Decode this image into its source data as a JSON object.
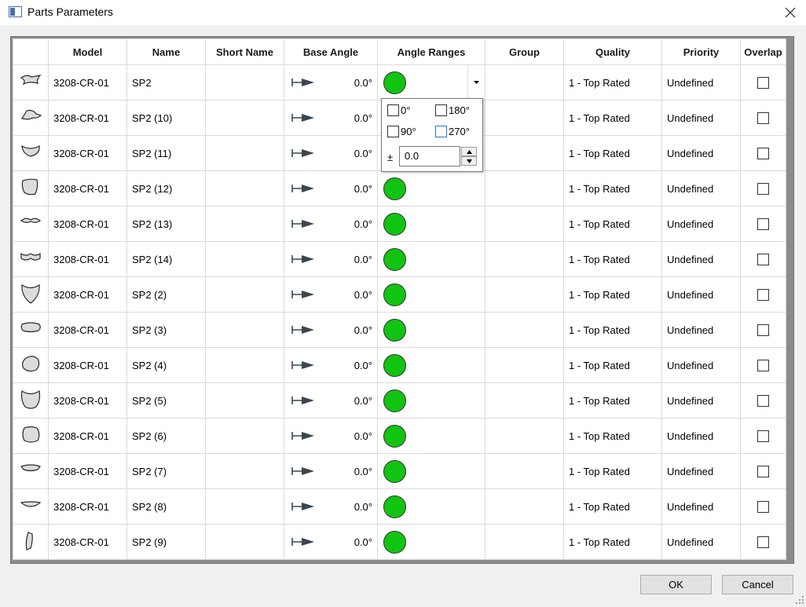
{
  "window": {
    "title": "Parts Parameters"
  },
  "columns": [
    "",
    "Model",
    "Name",
    "Short Name",
    "Base Angle",
    "Angle Ranges",
    "Group",
    "Quality",
    "Priority",
    "Overlap"
  ],
  "colors": {
    "range_dot": "#11c411",
    "focus_border": "#1e7fd6"
  },
  "rows": [
    {
      "icon": "part-shape-icon",
      "model": "3208-CR-01",
      "name": "SP2",
      "short_name": "",
      "base_angle": "0.0°",
      "group": "",
      "quality": "1 - Top Rated",
      "priority": "Undefined"
    },
    {
      "icon": "part-shape-icon",
      "model": "3208-CR-01",
      "name": "SP2 (10)",
      "short_name": "",
      "base_angle": "0.0°",
      "group": "",
      "quality": "1 - Top Rated",
      "priority": "Undefined"
    },
    {
      "icon": "part-shape-icon",
      "model": "3208-CR-01",
      "name": "SP2 (11)",
      "short_name": "",
      "base_angle": "0.0°",
      "group": "",
      "quality": "1 - Top Rated",
      "priority": "Undefined"
    },
    {
      "icon": "part-shape-icon",
      "model": "3208-CR-01",
      "name": "SP2 (12)",
      "short_name": "",
      "base_angle": "0.0°",
      "group": "",
      "quality": "1 - Top Rated",
      "priority": "Undefined"
    },
    {
      "icon": "part-shape-icon",
      "model": "3208-CR-01",
      "name": "SP2 (13)",
      "short_name": "",
      "base_angle": "0.0°",
      "group": "",
      "quality": "1 - Top Rated",
      "priority": "Undefined"
    },
    {
      "icon": "part-shape-icon",
      "model": "3208-CR-01",
      "name": "SP2 (14)",
      "short_name": "",
      "base_angle": "0.0°",
      "group": "",
      "quality": "1 - Top Rated",
      "priority": "Undefined"
    },
    {
      "icon": "part-shape-icon",
      "model": "3208-CR-01",
      "name": "SP2 (2)",
      "short_name": "",
      "base_angle": "0.0°",
      "group": "",
      "quality": "1 - Top Rated",
      "priority": "Undefined"
    },
    {
      "icon": "part-shape-icon",
      "model": "3208-CR-01",
      "name": "SP2 (3)",
      "short_name": "",
      "base_angle": "0.0°",
      "group": "",
      "quality": "1 - Top Rated",
      "priority": "Undefined"
    },
    {
      "icon": "part-shape-icon",
      "model": "3208-CR-01",
      "name": "SP2 (4)",
      "short_name": "",
      "base_angle": "0.0°",
      "group": "",
      "quality": "1 - Top Rated",
      "priority": "Undefined"
    },
    {
      "icon": "part-shape-icon",
      "model": "3208-CR-01",
      "name": "SP2 (5)",
      "short_name": "",
      "base_angle": "0.0°",
      "group": "",
      "quality": "1 - Top Rated",
      "priority": "Undefined"
    },
    {
      "icon": "part-shape-icon",
      "model": "3208-CR-01",
      "name": "SP2 (6)",
      "short_name": "",
      "base_angle": "0.0°",
      "group": "",
      "quality": "1 - Top Rated",
      "priority": "Undefined"
    },
    {
      "icon": "part-shape-icon",
      "model": "3208-CR-01",
      "name": "SP2 (7)",
      "short_name": "",
      "base_angle": "0.0°",
      "group": "",
      "quality": "1 - Top Rated",
      "priority": "Undefined"
    },
    {
      "icon": "part-shape-icon",
      "model": "3208-CR-01",
      "name": "SP2 (8)",
      "short_name": "",
      "base_angle": "0.0°",
      "group": "",
      "quality": "1 - Top Rated",
      "priority": "Undefined"
    },
    {
      "icon": "part-shape-icon",
      "model": "3208-CR-01",
      "name": "SP2 (9)",
      "short_name": "",
      "base_angle": "0.0°",
      "group": "",
      "quality": "1 - Top Rated",
      "priority": "Undefined"
    }
  ],
  "angle_popup": {
    "options": [
      "0°",
      "180°",
      "90°",
      "270°"
    ],
    "plus_minus": "±",
    "tolerance": "0.0"
  },
  "buttons": {
    "ok": "OK",
    "cancel": "Cancel"
  }
}
